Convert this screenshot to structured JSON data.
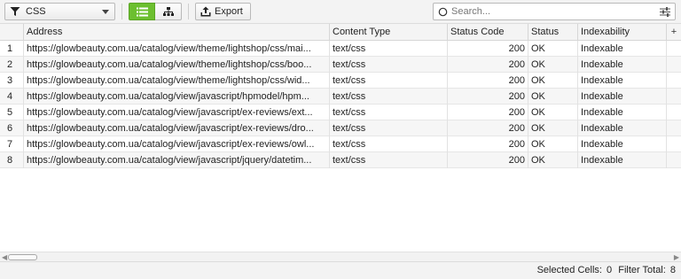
{
  "toolbar": {
    "filter_value": "CSS",
    "export_label": "Export",
    "search_placeholder": "Search...",
    "accent_color": "#6cbf2f"
  },
  "grid": {
    "columns": [
      "Address",
      "Content Type",
      "Status Code",
      "Status",
      "Indexability"
    ],
    "add_column": "+",
    "rows": [
      {
        "idx": "1",
        "address": "https://glowbeauty.com.ua/catalog/view/theme/lightshop/css/mai...",
        "content_type": "text/css",
        "status_code": "200",
        "status": "OK",
        "indexability": "Indexable"
      },
      {
        "idx": "2",
        "address": "https://glowbeauty.com.ua/catalog/view/theme/lightshop/css/boo...",
        "content_type": "text/css",
        "status_code": "200",
        "status": "OK",
        "indexability": "Indexable"
      },
      {
        "idx": "3",
        "address": "https://glowbeauty.com.ua/catalog/view/theme/lightshop/css/wid...",
        "content_type": "text/css",
        "status_code": "200",
        "status": "OK",
        "indexability": "Indexable"
      },
      {
        "idx": "4",
        "address": "https://glowbeauty.com.ua/catalog/view/javascript/hpmodel/hpm...",
        "content_type": "text/css",
        "status_code": "200",
        "status": "OK",
        "indexability": "Indexable"
      },
      {
        "idx": "5",
        "address": "https://glowbeauty.com.ua/catalog/view/javascript/ex-reviews/ext...",
        "content_type": "text/css",
        "status_code": "200",
        "status": "OK",
        "indexability": "Indexable"
      },
      {
        "idx": "6",
        "address": "https://glowbeauty.com.ua/catalog/view/javascript/ex-reviews/dro...",
        "content_type": "text/css",
        "status_code": "200",
        "status": "OK",
        "indexability": "Indexable"
      },
      {
        "idx": "7",
        "address": "https://glowbeauty.com.ua/catalog/view/javascript/ex-reviews/owl...",
        "content_type": "text/css",
        "status_code": "200",
        "status": "OK",
        "indexability": "Indexable"
      },
      {
        "idx": "8",
        "address": "https://glowbeauty.com.ua/catalog/view/javascript/jquery/datetim...",
        "content_type": "text/css",
        "status_code": "200",
        "status": "OK",
        "indexability": "Indexable"
      }
    ]
  },
  "statusbar": {
    "selected_label": "Selected Cells:",
    "selected_value": "0",
    "filter_label": "Filter Total:",
    "filter_value": "8"
  }
}
